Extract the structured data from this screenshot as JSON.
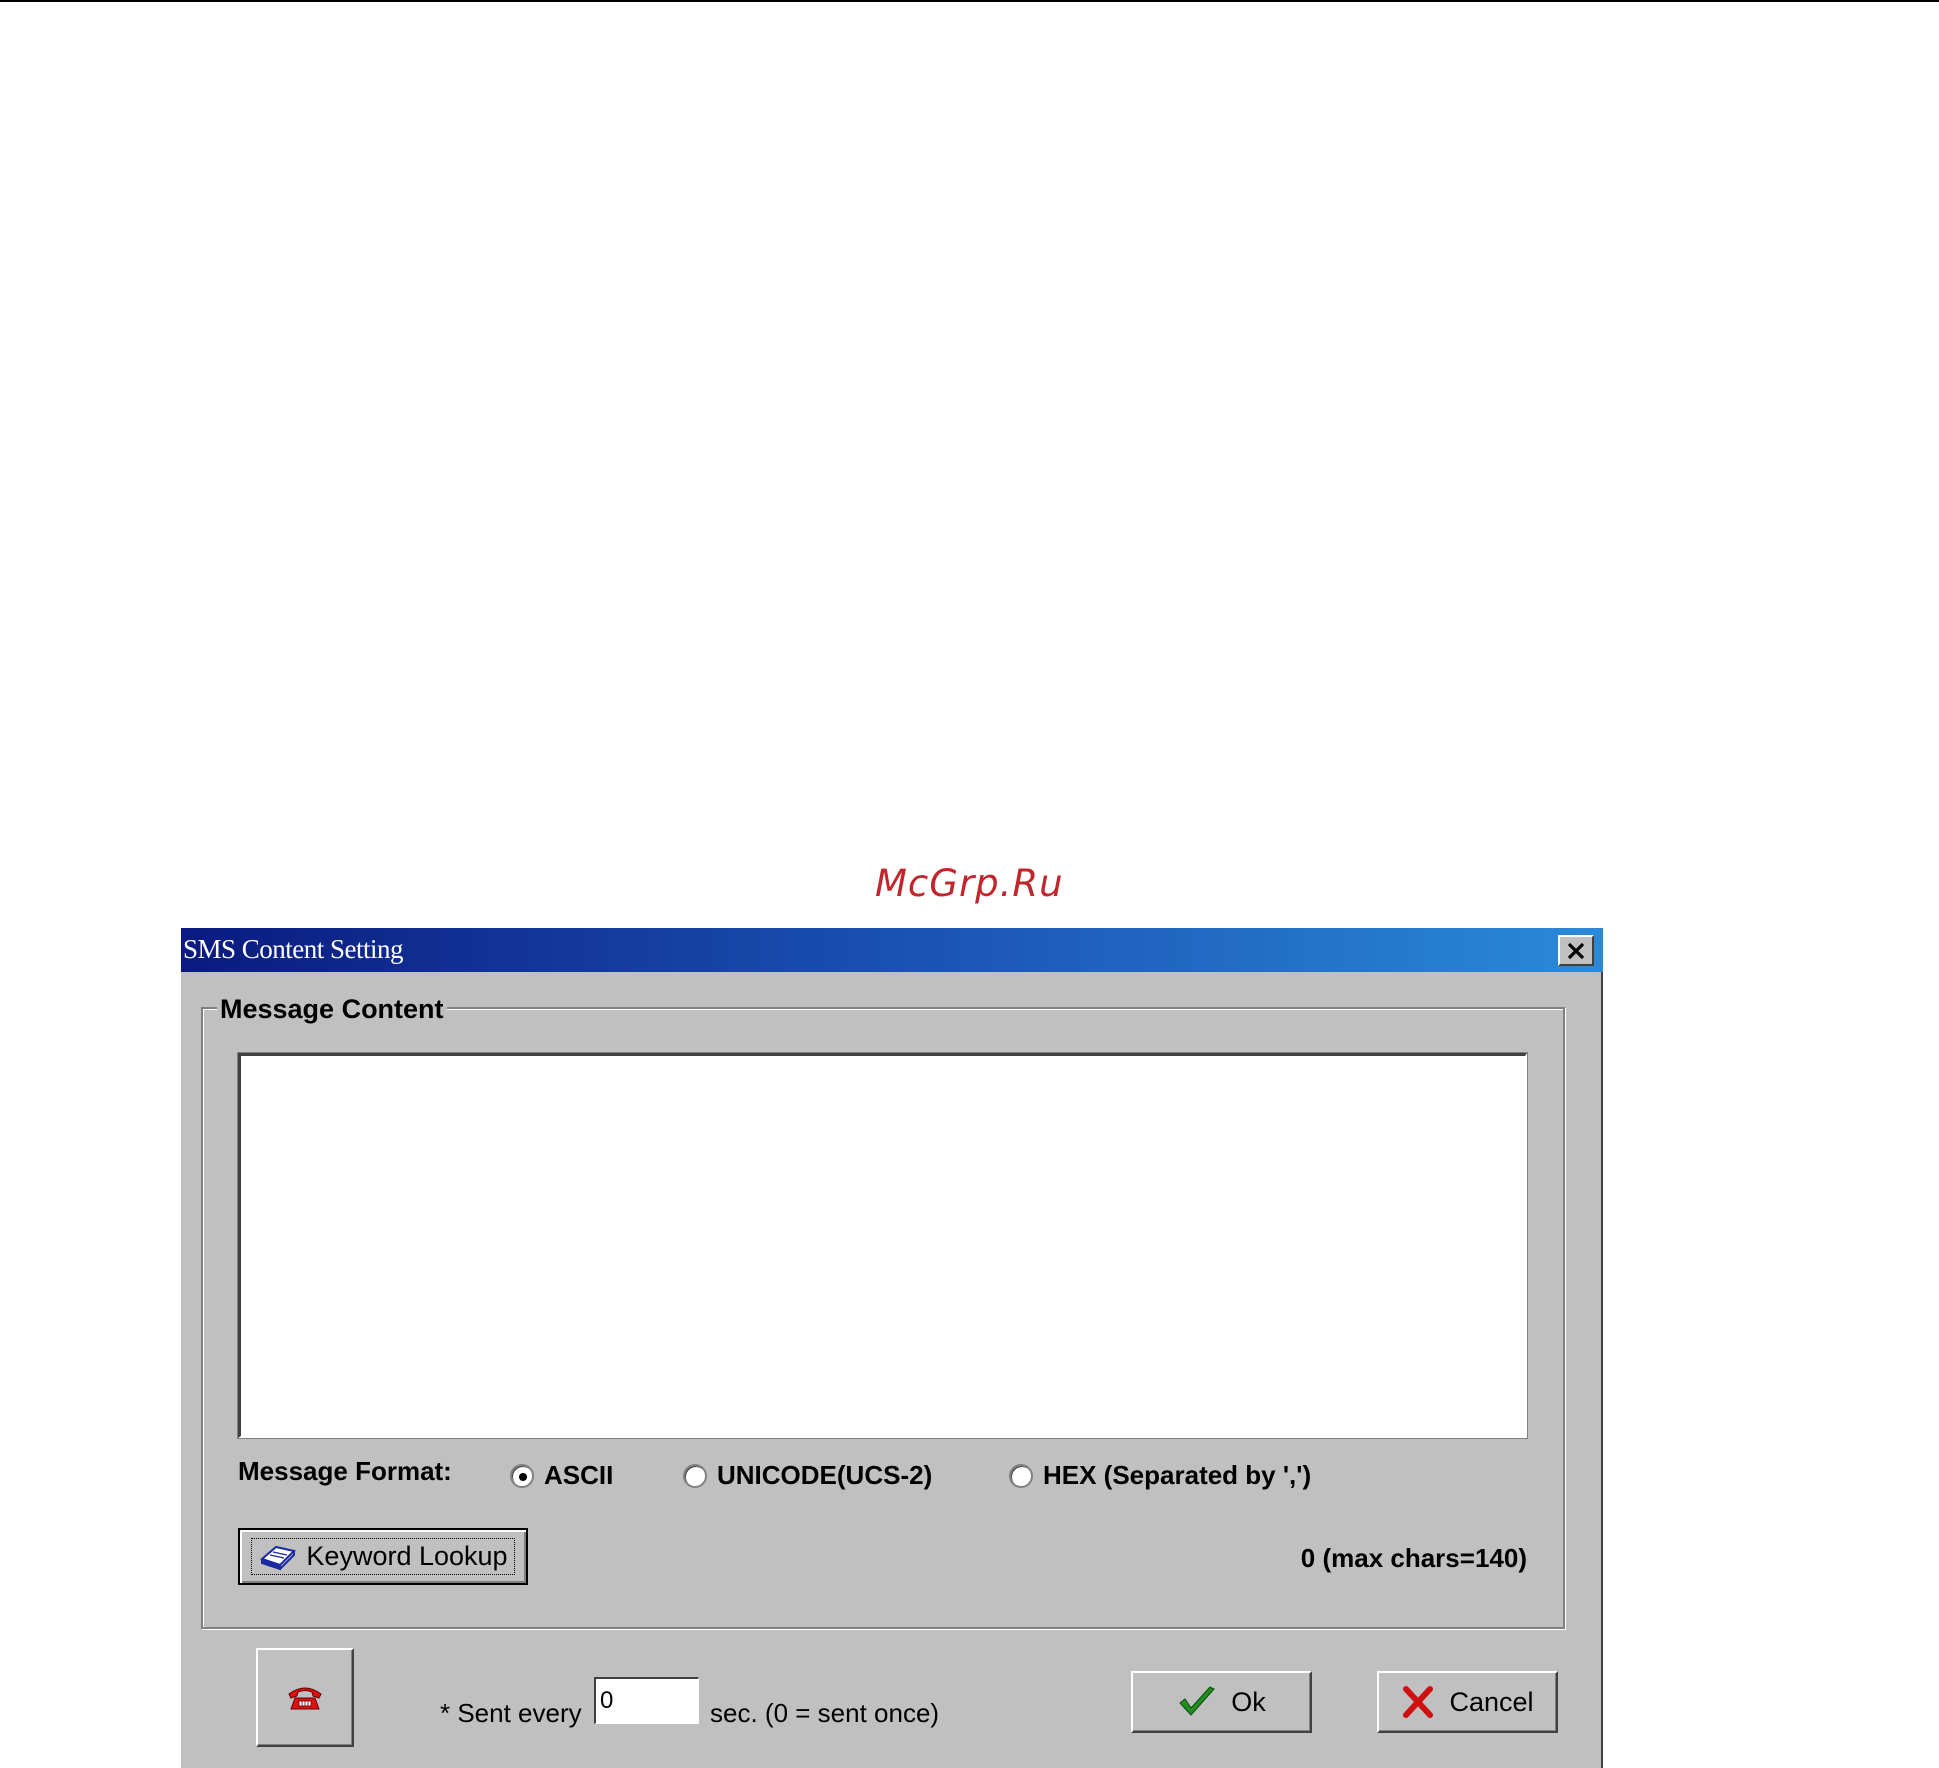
{
  "watermark": "McGrp.Ru",
  "window": {
    "title": "SMS Content Setting",
    "close_icon": "close-icon"
  },
  "message_content": {
    "group_label": "Message Content",
    "text_value": "",
    "format_label": "Message Format:",
    "formats": [
      {
        "label": "ASCII",
        "selected": true
      },
      {
        "label": "UNICODE(UCS-2)",
        "selected": false
      },
      {
        "label": "HEX (Separated by ',')",
        "selected": false
      }
    ],
    "keyword_button": "Keyword Lookup",
    "keyword_icon": "book-icon",
    "char_count": "0 (max chars=140)"
  },
  "footer": {
    "phone_icon": "phone-icon",
    "sent_every_label": "* Sent every",
    "interval_value": "0",
    "sec_label": "sec. (0 = sent once)",
    "ok_label": "Ok",
    "ok_icon": "checkmark-icon",
    "cancel_label": "Cancel",
    "cancel_icon": "x-mark-icon"
  },
  "colors": {
    "titlebar_start": "#0a1a80",
    "titlebar_end": "#2a8ad8",
    "dialog_face": "#c0c0c0",
    "watermark": "#c0272d",
    "ok_check": "#1f8f1f",
    "cancel_x": "#d01010",
    "phone": "#e01010"
  }
}
